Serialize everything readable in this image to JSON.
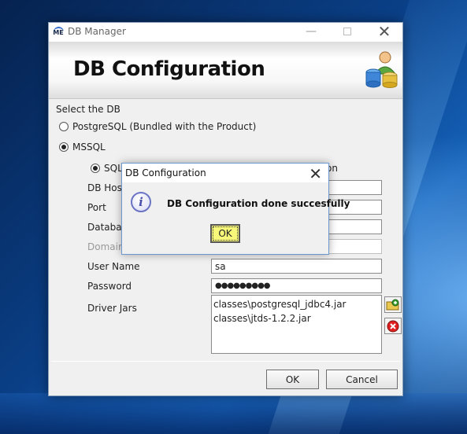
{
  "window": {
    "title": "DB Manager",
    "app_icon_text": "ME"
  },
  "banner": {
    "title": "DB Configuration"
  },
  "form": {
    "select_label": "Select the DB",
    "radio_postgres": "PostgreSQL (Bundled with the Product)",
    "radio_mssql": "MSSQL",
    "radio_sql_auth_visible": "SQL",
    "radio_other_visible": "on",
    "fields": {
      "db_host": "DB Host",
      "port": "Port",
      "database": "Databas",
      "domain": "Domain",
      "user_name": "User Name",
      "password": "Password",
      "driver_jars": "Driver Jars"
    },
    "values": {
      "user_name": "sa",
      "password_mask": "●●●●●●●●●"
    },
    "jars": [
      "classes\\postgresql_jdbc4.jar",
      "classes\\jtds-1.2.2.jar"
    ]
  },
  "buttons": {
    "ok": "OK",
    "cancel": "Cancel"
  },
  "dialog": {
    "title": "DB Configuration",
    "message": "DB Configuration done succesfully",
    "ok": "OK",
    "info_glyph": "i"
  },
  "icons": {
    "app": "app-logo-icon",
    "db_user": "database-user-icon",
    "add_jar": "add-folder-icon",
    "remove_jar": "remove-icon",
    "info": "info-icon"
  }
}
